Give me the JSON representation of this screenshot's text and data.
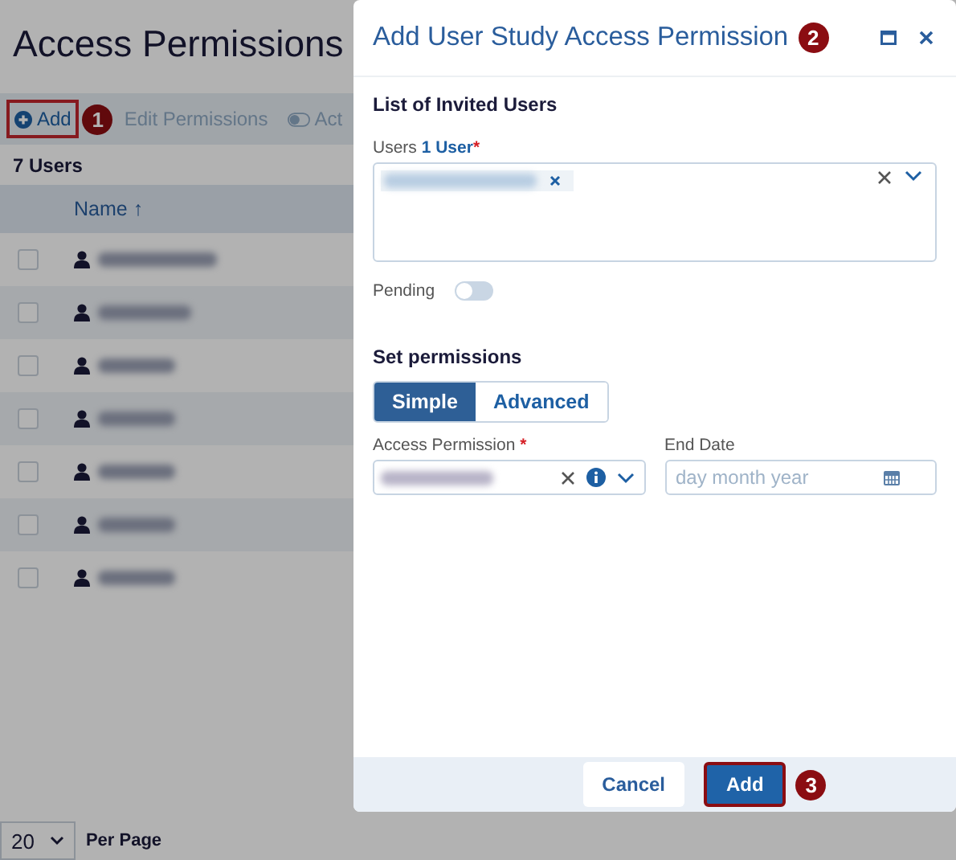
{
  "page": {
    "title": "Access Permissions",
    "toolbar": [
      {
        "kind": "add",
        "label": "Add",
        "disabled": false,
        "highlighted": true,
        "callout": "1"
      },
      {
        "kind": "edit",
        "label": "Edit Permissions",
        "disabled": true,
        "highlighted": false
      },
      {
        "kind": "toggle",
        "label": "Act",
        "disabled": true,
        "highlighted": false
      }
    ],
    "count": "7 Users",
    "table": {
      "columns": [
        {
          "label": "Name",
          "sort": "↑"
        }
      ],
      "rows": [
        {
          "checked": false
        },
        {
          "checked": false
        },
        {
          "checked": false
        },
        {
          "checked": false
        },
        {
          "checked": false
        },
        {
          "checked": false
        },
        {
          "checked": false
        }
      ]
    },
    "pager": {
      "value": "20",
      "label": "Per Page"
    }
  },
  "dialog": {
    "title": "Add User Study Access Permission",
    "callout": "2",
    "section_1": "List of Invited Users",
    "users_field": {
      "label": "Users",
      "count": "1 User",
      "required_mark": "*"
    },
    "pending": {
      "label": "Pending",
      "on": false
    },
    "section_2": "Set permissions",
    "modes": [
      {
        "label": "Simple",
        "selected": true
      },
      {
        "label": "Advanced",
        "selected": false
      }
    ],
    "access_field": {
      "label": "Access Permission",
      "required_mark": "*"
    },
    "end_date": {
      "label": "End Date",
      "placeholder": "day month year"
    },
    "buttons": [
      {
        "kind": "secondary",
        "label": "Cancel",
        "highlighted": false
      },
      {
        "kind": "primary",
        "label": "Add",
        "highlighted": true,
        "callout": "3"
      }
    ]
  }
}
